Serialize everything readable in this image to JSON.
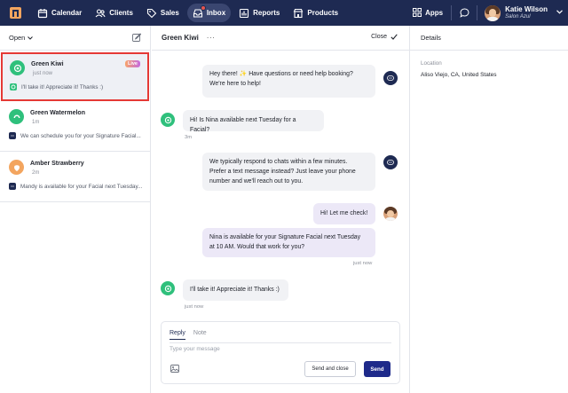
{
  "nav": {
    "items": [
      {
        "label": "Calendar",
        "icon": "calendar-icon"
      },
      {
        "label": "Clients",
        "icon": "clients-icon"
      },
      {
        "label": "Sales",
        "icon": "tag-icon"
      },
      {
        "label": "Inbox",
        "icon": "inbox-icon"
      },
      {
        "label": "Reports",
        "icon": "bar-chart-icon"
      },
      {
        "label": "Products",
        "icon": "store-icon"
      }
    ],
    "active": "Inbox",
    "apps_label": "Apps",
    "user_name": "Katie Wilson",
    "user_org": "Salon Azul"
  },
  "colors": {
    "nav_bg": "#1e2a52",
    "accent": "#1e2a8a",
    "green": "#2fc07c",
    "orange": "#f3a55f",
    "selection_outline": "#e53935"
  },
  "sidebar": {
    "filter_label": "Open",
    "conversations": [
      {
        "name": "Green Kiwi",
        "time": "just now",
        "badge": "Live",
        "preview": "I'll take it! Appreciate it! Thanks :)"
      },
      {
        "name": "Green Watermelon",
        "time": "1m",
        "badge": "",
        "preview": "We can schedule you for your Signature Facial..."
      },
      {
        "name": "Amber Strawberry",
        "time": "2m",
        "badge": "",
        "preview": "Mandy is available for your Facial next Tuesday..."
      }
    ]
  },
  "chat": {
    "title": "Green Kiwi",
    "more_label": "···",
    "close_label": "Close",
    "messages": [
      {
        "from": "bot",
        "line1": "Hey there! ✨ Have questions or need help booking?",
        "line2": "We're here to help!"
      },
      {
        "from": "client",
        "text": "Hi! Is Nina available next Tuesday for a Facial?",
        "meta": "3m"
      },
      {
        "from": "bot",
        "line1": "We typically respond to chats within a few minutes.",
        "line2": "Prefer a text message instead? Just leave your phone",
        "line3": "number and we'll reach out to you."
      },
      {
        "from": "staff",
        "text": "Hi! Let me check!"
      },
      {
        "from": "staff",
        "line1": "Nina is available for your Signature Facial next Tuesday",
        "line2": "at 10 AM. Would that work for you?",
        "meta": "just now"
      },
      {
        "from": "client",
        "text": "I'll take it! Appreciate it! Thanks :)",
        "meta": "just now"
      }
    ]
  },
  "composer": {
    "tabs": [
      "Reply",
      "Note"
    ],
    "placeholder": "Type your message",
    "send_close_label": "Send and close",
    "send_label": "Send"
  },
  "details": {
    "title": "Details",
    "location_label": "Location",
    "location_value": "Aliso Viejo, CA, United States"
  }
}
